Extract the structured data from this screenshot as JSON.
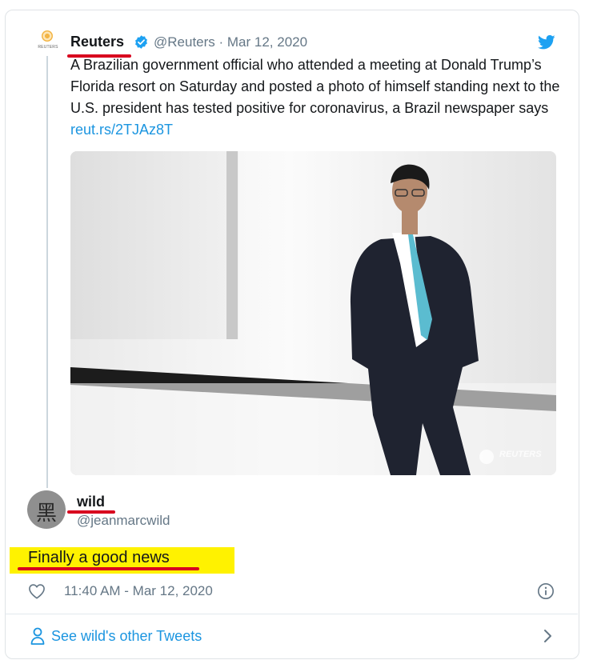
{
  "original_tweet": {
    "logo_text": "REUTERS",
    "author_name": "Reuters",
    "handle_date": "@Reuters · Mar 12, 2020",
    "text": "A Brazilian government official who attended a meeting at Donald Trump’s Florida resort on Saturday and posted a photo of himself standing next to the U.S. president has tested positive for coronavirus, a Brazil newspaper says ",
    "link": "reut.rs/2TJAz8T",
    "photo_watermark": "REUTERS",
    "icons": [
      "verified-badge-icon",
      "twitter-bird-icon"
    ]
  },
  "reply": {
    "author_name": "wild",
    "handle": "@jeanmarcwild",
    "avatar_glyph": "黑え",
    "text": "Finally a good news",
    "timestamp": "11:40 AM - Mar 12, 2020",
    "icons": [
      "heart-icon",
      "info-icon"
    ]
  },
  "footer": {
    "see_more": "See wild's other Tweets",
    "icons": [
      "person-icon",
      "chevron-right-icon"
    ]
  },
  "colors": {
    "link": "#1b95e0",
    "secondary_text": "#657786",
    "annotation_red": "#d8001e",
    "annotation_yellow": "#fff200",
    "border": "#dfe3e6"
  }
}
